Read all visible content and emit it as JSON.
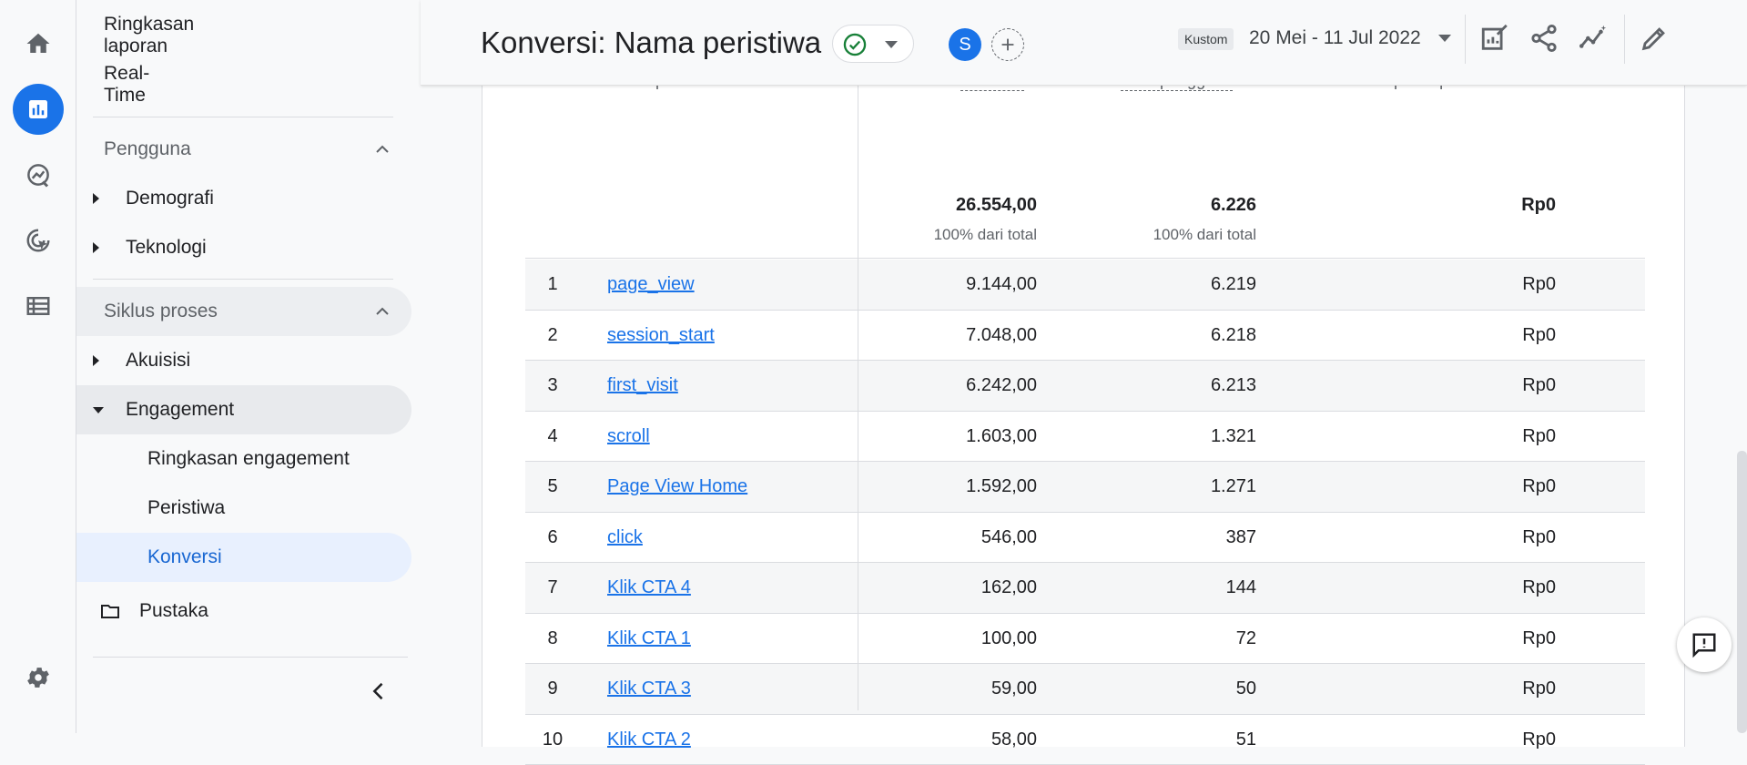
{
  "rail": {
    "icons": [
      "home-icon",
      "reports-icon",
      "explore-icon",
      "advertising-icon",
      "configure-icon",
      "settings-icon"
    ]
  },
  "nav": {
    "ringkasan": "Ringkasan laporan",
    "realtime": "Real-Time",
    "pengguna": "Pengguna",
    "demografi": "Demografi",
    "teknologi": "Teknologi",
    "siklus": "Siklus proses",
    "akuisisi": "Akuisisi",
    "engagement": "Engagement",
    "ringkasan_engagement": "Ringkasan engagement",
    "peristiwa": "Peristiwa",
    "konversi": "Konversi",
    "pustaka": "Pustaka"
  },
  "header": {
    "title": "Konversi: Nama peristiwa",
    "avatar": "S",
    "kustom": "Kustom",
    "daterange": "20 Mei - 11 Jul 2022"
  },
  "table": {
    "headers": {
      "name": "Nama peristiwa",
      "conversions": "Konversi",
      "users": "Total pengguna",
      "revenue": "Pendapatan peristiwa"
    },
    "totals": {
      "conversions": "26.554,00",
      "conversions_sub": "100% dari total",
      "users": "6.226",
      "users_sub": "100% dari total",
      "revenue": "Rp0"
    },
    "rows": [
      {
        "num": "1",
        "name": "page_view",
        "conversions": "9.144,00",
        "users": "6.219",
        "revenue": "Rp0"
      },
      {
        "num": "2",
        "name": "session_start",
        "conversions": "7.048,00",
        "users": "6.218",
        "revenue": "Rp0"
      },
      {
        "num": "3",
        "name": "first_visit",
        "conversions": "6.242,00",
        "users": "6.213",
        "revenue": "Rp0"
      },
      {
        "num": "4",
        "name": "scroll",
        "conversions": "1.603,00",
        "users": "1.321",
        "revenue": "Rp0"
      },
      {
        "num": "5",
        "name": "Page View Home",
        "conversions": "1.592,00",
        "users": "1.271",
        "revenue": "Rp0"
      },
      {
        "num": "6",
        "name": "click",
        "conversions": "546,00",
        "users": "387",
        "revenue": "Rp0"
      },
      {
        "num": "7",
        "name": "Klik CTA 4",
        "conversions": "162,00",
        "users": "144",
        "revenue": "Rp0"
      },
      {
        "num": "8",
        "name": "Klik CTA 1",
        "conversions": "100,00",
        "users": "72",
        "revenue": "Rp0"
      },
      {
        "num": "9",
        "name": "Klik CTA 3",
        "conversions": "59,00",
        "users": "50",
        "revenue": "Rp0"
      },
      {
        "num": "10",
        "name": "Klik CTA 2",
        "conversions": "58,00",
        "users": "51",
        "revenue": "Rp0"
      }
    ]
  },
  "colors": {
    "accent": "#1a73e8",
    "success": "#188038"
  }
}
